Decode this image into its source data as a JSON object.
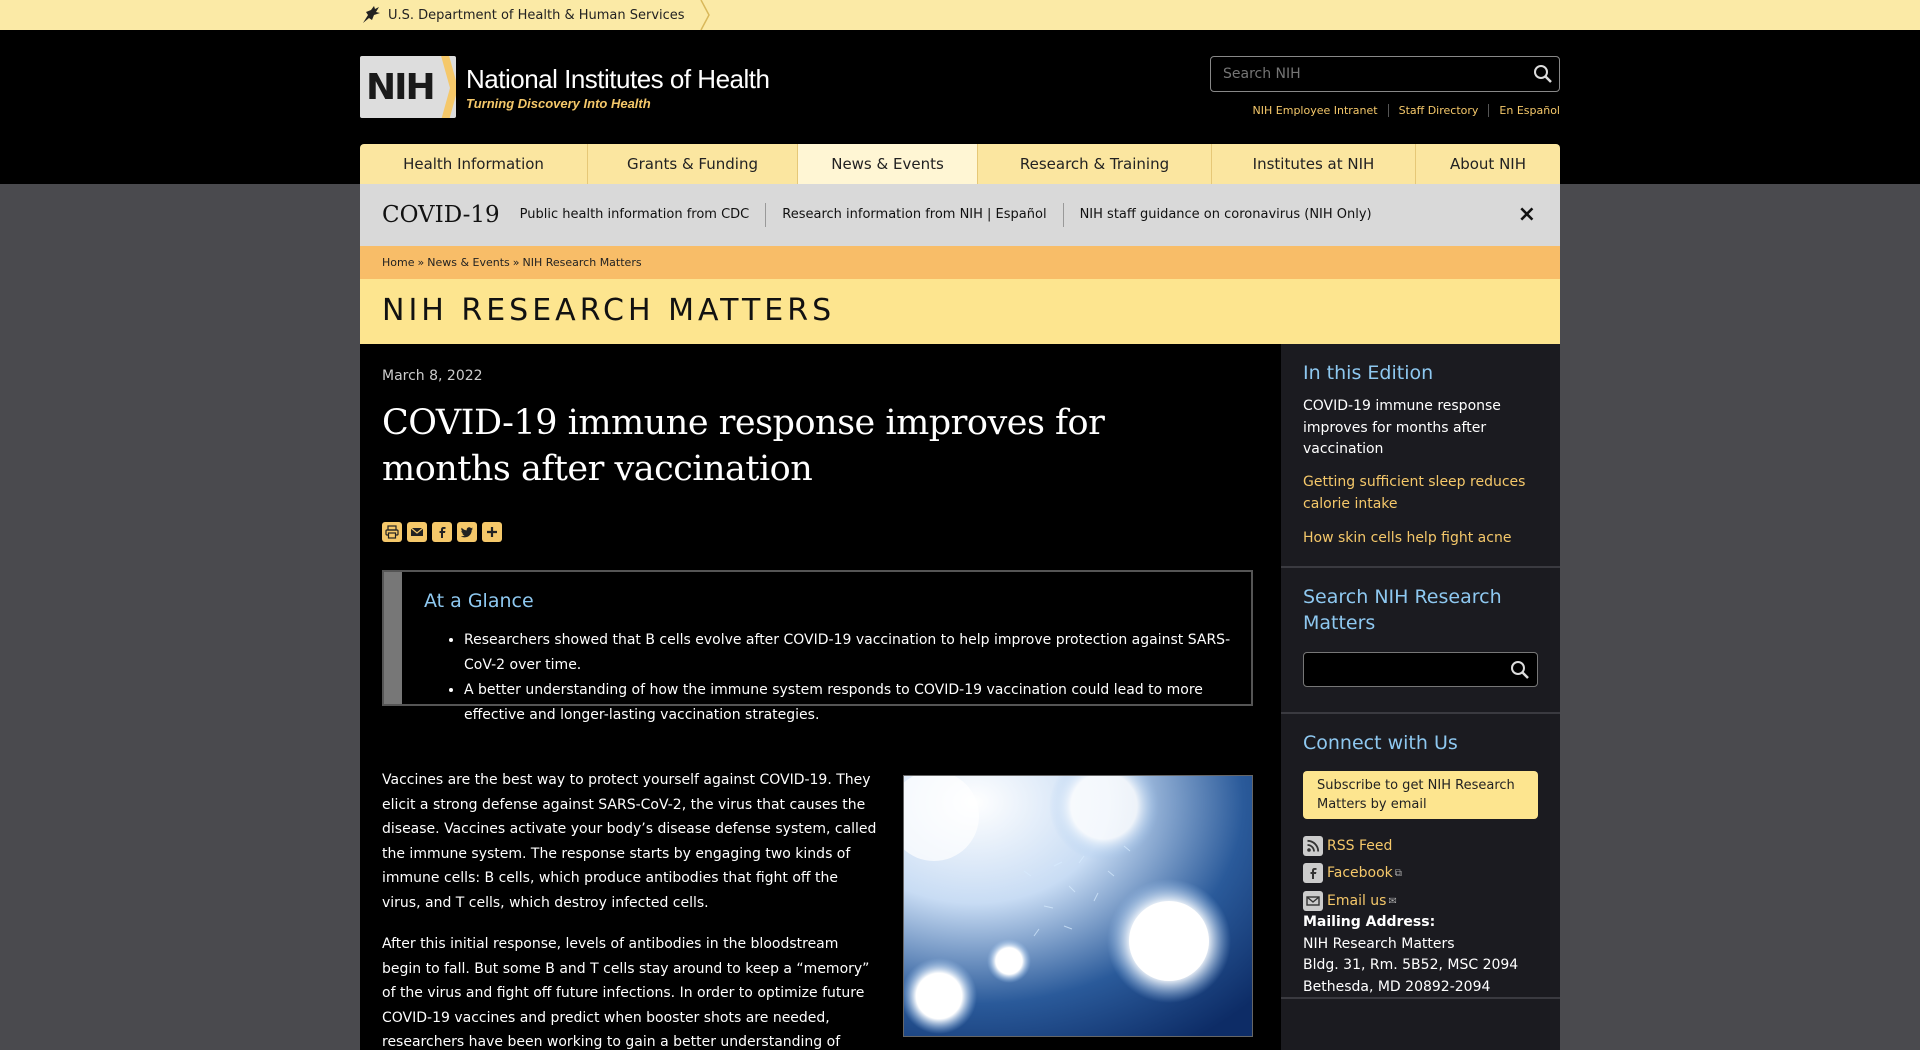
{
  "hhs": {
    "text": "U.S. Department of Health & Human Services"
  },
  "header": {
    "logo_mark": "NIH",
    "logo_title": "National Institutes of Health",
    "logo_subtitle": "Turning Discovery Into Health",
    "search_placeholder": "Search NIH",
    "utility_links": [
      "NIH Employee Intranet",
      "Staff Directory",
      "En Español"
    ]
  },
  "nav": {
    "items": [
      {
        "label": "Health Information"
      },
      {
        "label": "Grants & Funding"
      },
      {
        "label": "News & Events"
      },
      {
        "label": "Research & Training"
      },
      {
        "label": "Institutes at NIH"
      },
      {
        "label": "About NIH"
      }
    ],
    "active": "News & Events"
  },
  "covid": {
    "title": "COVID-19",
    "links": [
      "Public health information from CDC",
      "Research information from NIH | Español",
      "NIH staff guidance on coronavirus (NIH Only)"
    ],
    "close": "×"
  },
  "breadcrumb": {
    "items": [
      "Home",
      "News & Events",
      "NIH Research Matters"
    ],
    "separator": "»"
  },
  "banner": {
    "title": "NIH RESEARCH MATTERS"
  },
  "article": {
    "date": "March 8, 2022",
    "title": "COVID-19 immune response improves for months after vaccination",
    "share_icons": [
      "print-icon",
      "email-icon",
      "facebook-icon",
      "twitter-icon",
      "plus-icon"
    ],
    "glance": {
      "heading": "At a Glance",
      "points": [
        "Researchers showed that B cells evolve after COVID-19 vaccination to help improve protection against SARS-CoV-2 over time.",
        "A better understanding of how the immune system responds to COVID-19 vaccination could lead to more effective and longer-lasting vaccination strategies."
      ]
    },
    "paragraphs": [
      "Vaccines are the best way to protect yourself against COVID-19. They elicit a strong defense against SARS-CoV-2, the virus that causes the disease. Vaccines activate your body’s disease defense system, called the immune system. The response starts by engaging two kinds of immune cells: B cells, which produce antibodies that fight off the virus, and T cells, which destroy infected cells.",
      "After this initial response, levels of antibodies in the bloodstream begin to fall. But some B and T cells stay around to keep a “memory” of the virus and fight off future infections. In order to optimize future COVID-19 vaccines and predict when booster shots are needed, researchers have been working to gain a better understanding of these memory cells."
    ]
  },
  "sidebar": {
    "edition": {
      "heading": "In this Edition",
      "items": [
        {
          "label": "COVID-19 immune response improves for months after vaccination",
          "current": true
        },
        {
          "label": "Getting sufficient sleep reduces calorie intake",
          "current": false
        },
        {
          "label": "How skin cells help fight acne",
          "current": false
        }
      ]
    },
    "search": {
      "heading": "Search NIH Research Matters"
    },
    "connect": {
      "heading": "Connect with Us",
      "subscribe": "Subscribe to get NIH Research Matters by email",
      "links": [
        {
          "label": "RSS Feed",
          "icon": "rss-icon"
        },
        {
          "label": "Facebook",
          "icon": "facebook-icon"
        },
        {
          "label": "Email us",
          "icon": "email-icon"
        }
      ],
      "mailing_label": "Mailing Address:",
      "mailing_lines": [
        "NIH Research Matters",
        "Bldg. 31, Rm. 5B52, MSC 2094",
        "Bethesda, MD 20892-2094"
      ]
    }
  }
}
